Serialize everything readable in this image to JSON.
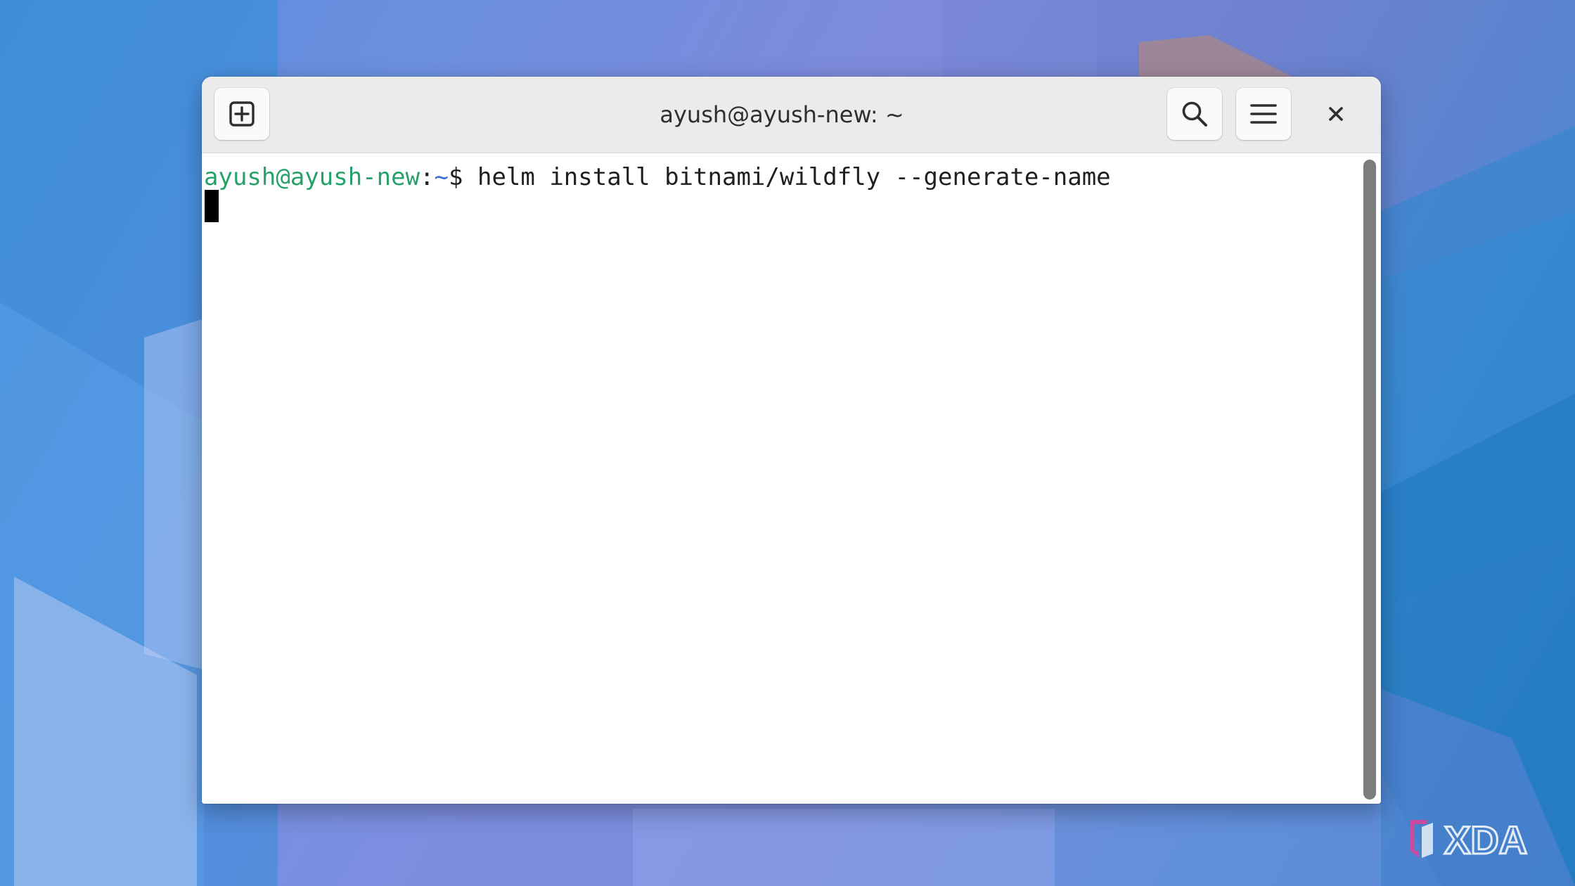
{
  "window": {
    "title": "ayush@ayush-new: ~"
  },
  "headerbar": {
    "new_tab_icon": "new-tab-icon",
    "search_icon": "search-icon",
    "menu_icon": "hamburger-menu-icon",
    "close_icon": "close-icon"
  },
  "terminal": {
    "prompt_user_host": "ayush@ayush-new",
    "prompt_separator": ":",
    "prompt_path": "~",
    "prompt_symbol": "$",
    "command": "helm install bitnami/wildfly --generate-name"
  },
  "watermark": {
    "text": "XDA"
  },
  "colors": {
    "prompt_user": "#26a269",
    "prompt_path": "#3c6fd1",
    "headerbar": "#ebebeb",
    "terminal_bg": "#ffffff",
    "cursor": "#000000"
  }
}
